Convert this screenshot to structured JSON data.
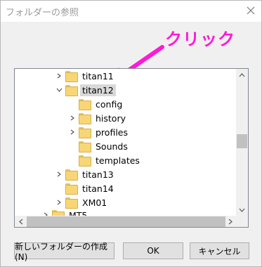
{
  "dialog": {
    "title": "フォルダーの参照",
    "annotation": "クリック",
    "annotation_color": "#ff19d8"
  },
  "tree": {
    "rows": [
      {
        "label": "titan11",
        "expander": "collapsed",
        "selected": false
      },
      {
        "label": "titan12",
        "expander": "expanded",
        "selected": true
      },
      {
        "label": "config",
        "expander": "none",
        "selected": false
      },
      {
        "label": "history",
        "expander": "collapsed",
        "selected": false
      },
      {
        "label": "profiles",
        "expander": "collapsed",
        "selected": false
      },
      {
        "label": "Sounds",
        "expander": "none",
        "selected": false
      },
      {
        "label": "templates",
        "expander": "none",
        "selected": false
      },
      {
        "label": "titan13",
        "expander": "collapsed",
        "selected": false
      },
      {
        "label": "titan14",
        "expander": "none",
        "selected": false
      },
      {
        "label": "XM01",
        "expander": "collapsed",
        "selected": false
      },
      {
        "label": "MT5",
        "expander": "collapsed",
        "selected": false
      }
    ]
  },
  "buttons": {
    "new_folder": "新しいフォルダーの作成(N)",
    "ok": "OK",
    "cancel": "キャンセル"
  },
  "icons": {
    "close": "close-icon",
    "folder": "folder-icon",
    "expand": "chevron-right-icon",
    "collapse": "chevron-down-icon"
  }
}
